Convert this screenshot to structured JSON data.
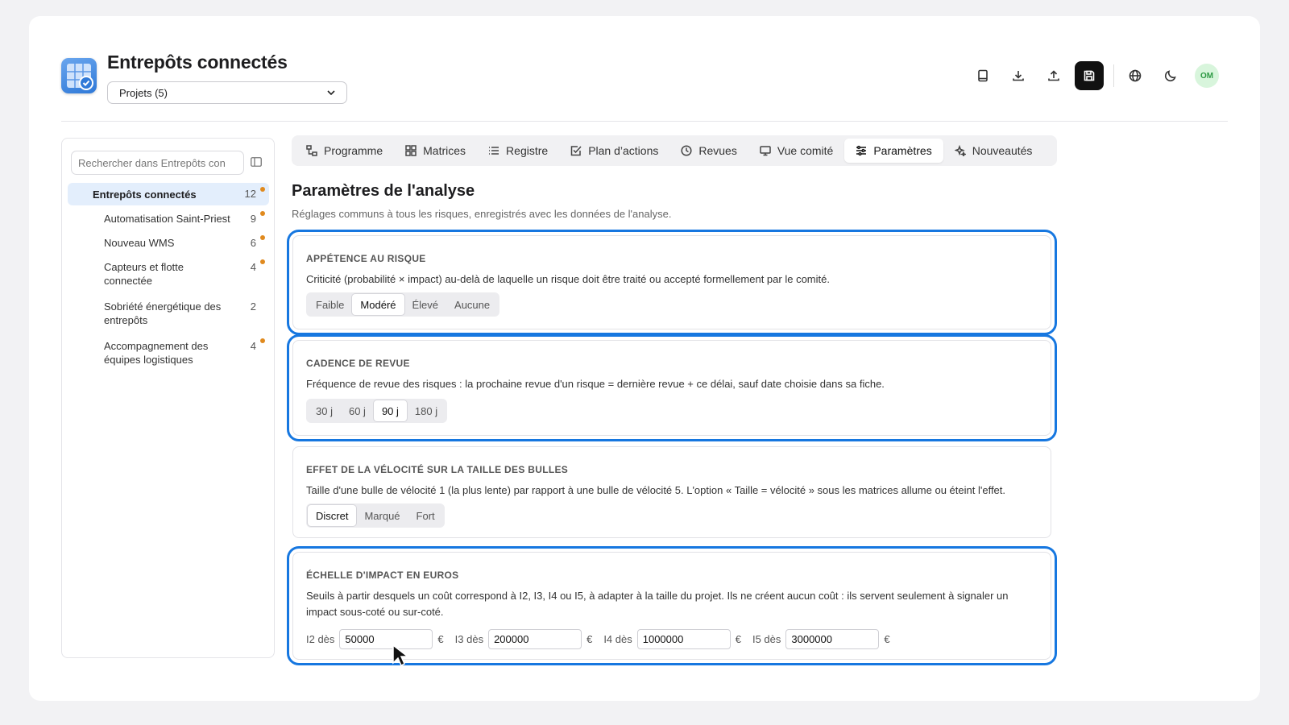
{
  "app": {
    "title": "Entrepôts connectés"
  },
  "project_select": {
    "value": "Projets (5)"
  },
  "toolbar": {
    "icons": [
      "book-icon",
      "download-icon",
      "upload-icon",
      "save-icon",
      "globe-icon",
      "moon-icon"
    ],
    "avatar_initials": "OM"
  },
  "sidebar": {
    "search_placeholder": "Rechercher dans Entrepôts con",
    "root": {
      "label": "Entrepôts connectés",
      "count": "12"
    },
    "items": [
      {
        "label": "Automatisation Saint-Priest",
        "count": "9",
        "dot": true
      },
      {
        "label": "Nouveau WMS",
        "count": "6",
        "dot": true
      },
      {
        "label": "Capteurs et flotte connectée",
        "count": "4",
        "dot": true
      },
      {
        "label": "Sobriété énergétique des entrepôts",
        "count": "2",
        "dot": false
      },
      {
        "label": "Accompagnement des équipes logistiques",
        "count": "4",
        "dot": true
      }
    ]
  },
  "tabs": [
    {
      "label": "Programme",
      "icon": "org-chart-icon"
    },
    {
      "label": "Matrices",
      "icon": "grid-icon"
    },
    {
      "label": "Registre",
      "icon": "list-icon"
    },
    {
      "label": "Plan d’actions",
      "icon": "checkbox-icon"
    },
    {
      "label": "Revues",
      "icon": "clock-icon"
    },
    {
      "label": "Vue comité",
      "icon": "monitor-icon"
    },
    {
      "label": "Paramètres",
      "icon": "sliders-icon",
      "active": true
    },
    {
      "label": "Nouveautés",
      "icon": "sparkle-icon"
    }
  ],
  "page": {
    "title": "Paramètres de l'analyse",
    "subtitle": "Réglages communs à tous les risques, enregistrés avec les données de l'analyse."
  },
  "settings": {
    "appetence": {
      "title": "APPÉTENCE AU RISQUE",
      "description": "Criticité (probabilité × impact) au-delà de laquelle un risque doit être traité ou accepté formellement par le comité.",
      "options": [
        "Faible",
        "Modéré",
        "Élevé",
        "Aucune"
      ],
      "selected": "Modéré"
    },
    "cadence": {
      "title": "CADENCE DE REVUE",
      "description": "Fréquence de revue des risques : la prochaine revue d'un risque = dernière revue + ce délai, sauf date choisie dans sa fiche.",
      "options": [
        "30 j",
        "60 j",
        "90 j",
        "180 j"
      ],
      "selected": "90 j"
    },
    "velocite": {
      "title": "EFFET DE LA VÉLOCITÉ SUR LA TAILLE DES BULLES",
      "description": "Taille d'une bulle de vélocité 1 (la plus lente) par rapport à une bulle de vélocité 5. L'option « Taille = vélocité » sous les matrices allume ou éteint l'effet.",
      "options": [
        "Discret",
        "Marqué",
        "Fort"
      ],
      "selected": "Discret"
    },
    "echelle": {
      "title": "ÉCHELLE D'IMPACT EN EUROS",
      "description": "Seuils à partir desquels un coût correspond à I2, I3, I4 ou I5, à adapter à la taille du projet. Ils ne créent aucun coût : ils servent seulement à signaler un impact sous-coté ou sur-coté.",
      "unit": "€",
      "thresholds": [
        {
          "label": "I2 dès",
          "value": "50000"
        },
        {
          "label": "I3 dès",
          "value": "200000"
        },
        {
          "label": "I4 dès",
          "value": "1000000"
        },
        {
          "label": "I5 dès",
          "value": "3000000"
        }
      ]
    }
  }
}
